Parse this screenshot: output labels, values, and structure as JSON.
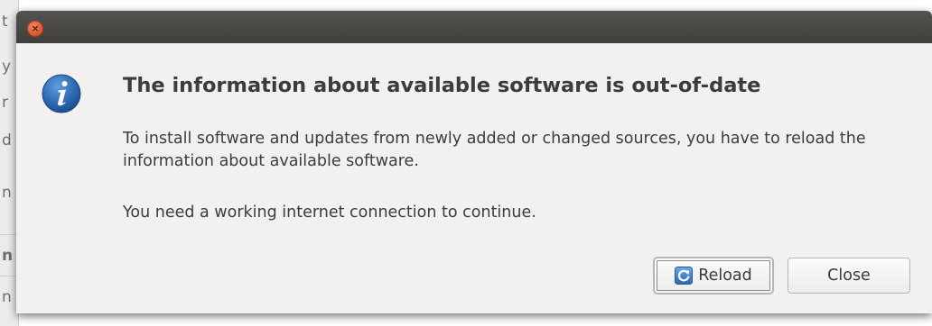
{
  "dialog": {
    "heading": "The information about available software is out-of-date",
    "body": "To install software and updates from newly added or changed sources, you have to reload the information about available software.",
    "note": "You need a working internet connection to continue.",
    "buttons": {
      "reload": "Reload",
      "close": "Close"
    },
    "titlebar_close_glyph": "×",
    "icon": "info-icon"
  },
  "background_window": {
    "glyph_fragments": [
      "t",
      "y",
      "r",
      "d",
      "n",
      "n",
      "n"
    ]
  },
  "colors": {
    "titlebar": "#4a4946",
    "dialog_bg": "#f2f1f0",
    "close_button": "#e25a33",
    "info_icon": "#2f6db5",
    "text": "#3c3c3c"
  }
}
